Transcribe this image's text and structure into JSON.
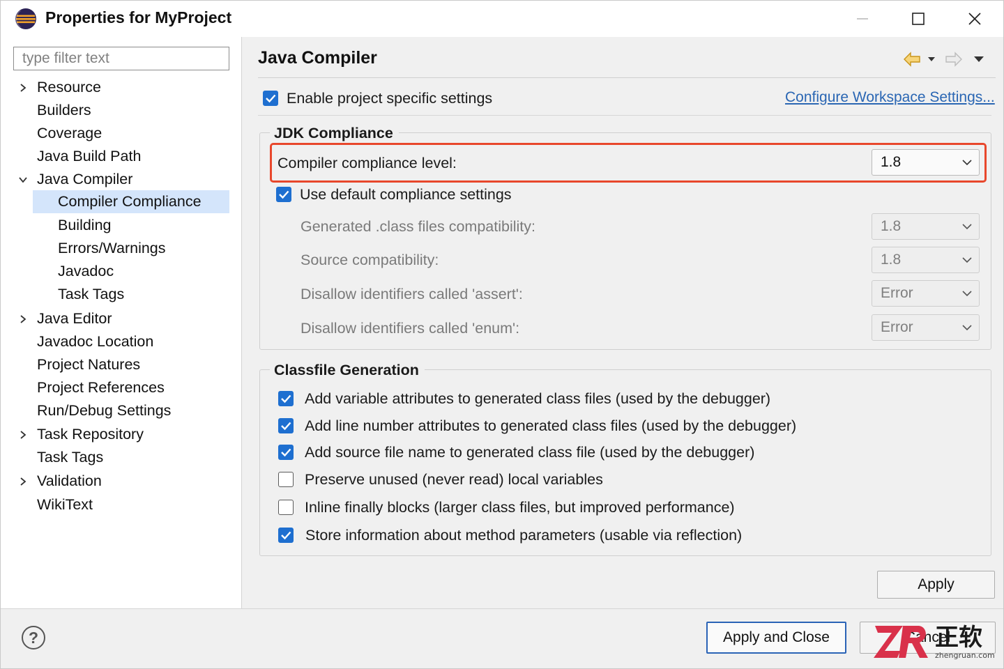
{
  "window": {
    "title": "Properties for MyProject"
  },
  "sidebar": {
    "filter_placeholder": "type filter text",
    "items": [
      {
        "label": "Resource",
        "expandable": true,
        "expanded": false,
        "level": 0
      },
      {
        "label": "Builders",
        "level": 0
      },
      {
        "label": "Coverage",
        "level": 0
      },
      {
        "label": "Java Build Path",
        "level": 0
      },
      {
        "label": "Java Compiler",
        "expandable": true,
        "expanded": true,
        "level": 0
      },
      {
        "label": "Compiler Compliance",
        "level": 1,
        "selected": true
      },
      {
        "label": "Building",
        "level": 1
      },
      {
        "label": "Errors/Warnings",
        "level": 1
      },
      {
        "label": "Javadoc",
        "level": 1
      },
      {
        "label": "Task Tags",
        "level": 1
      },
      {
        "label": "Java Editor",
        "expandable": true,
        "expanded": false,
        "level": 0
      },
      {
        "label": "Javadoc Location",
        "level": 0
      },
      {
        "label": "Project Natures",
        "level": 0
      },
      {
        "label": "Project References",
        "level": 0
      },
      {
        "label": "Run/Debug Settings",
        "level": 0
      },
      {
        "label": "Task Repository",
        "expandable": true,
        "expanded": false,
        "level": 0
      },
      {
        "label": "Task Tags",
        "level": 0
      },
      {
        "label": "Validation",
        "expandable": true,
        "expanded": false,
        "level": 0
      },
      {
        "label": "WikiText",
        "level": 0
      }
    ]
  },
  "main": {
    "title": "Java Compiler",
    "nav_icons": [
      "back-arrow-icon",
      "dropdown-icon",
      "forward-arrow-icon",
      "view-menu-icon"
    ],
    "enable_specific": {
      "label": "Enable project specific settings",
      "checked": true
    },
    "configure_link": "Configure Workspace Settings...",
    "jdk": {
      "title": "JDK Compliance",
      "compliance_label": "Compiler compliance level:",
      "compliance_value": "1.8",
      "use_default": {
        "label": "Use default compliance settings",
        "checked": true
      },
      "rows": [
        {
          "label": "Generated .class files compatibility:",
          "value": "1.8"
        },
        {
          "label": "Source compatibility:",
          "value": "1.8"
        },
        {
          "label": "Disallow identifiers called 'assert':",
          "value": "Error"
        },
        {
          "label": "Disallow identifiers called 'enum':",
          "value": "Error"
        }
      ]
    },
    "classfile": {
      "title": "Classfile Generation",
      "options": [
        {
          "label": "Add variable attributes to generated class files (used by the debugger)",
          "checked": true
        },
        {
          "label": "Add line number attributes to generated class files (used by the debugger)",
          "checked": true
        },
        {
          "label": "Add source file name to generated class file (used by the debugger)",
          "checked": true
        },
        {
          "label": "Preserve unused (never read) local variables",
          "checked": false
        },
        {
          "label": "Inline finally blocks (larger class files, but improved performance)",
          "checked": false
        },
        {
          "label": "Store information about method parameters (usable via reflection)",
          "checked": true
        }
      ]
    },
    "apply_label": "Apply"
  },
  "footer": {
    "help_label": "?",
    "apply_close_label": "Apply and Close",
    "cancel_label": "Cancel"
  },
  "watermark": {
    "brand": "正软",
    "url": "zhengruan.com"
  },
  "colors": {
    "accent": "#1e6fd0",
    "selection": "#d4e5fb",
    "highlight_border": "#e8472c",
    "link": "#2a66b3"
  }
}
